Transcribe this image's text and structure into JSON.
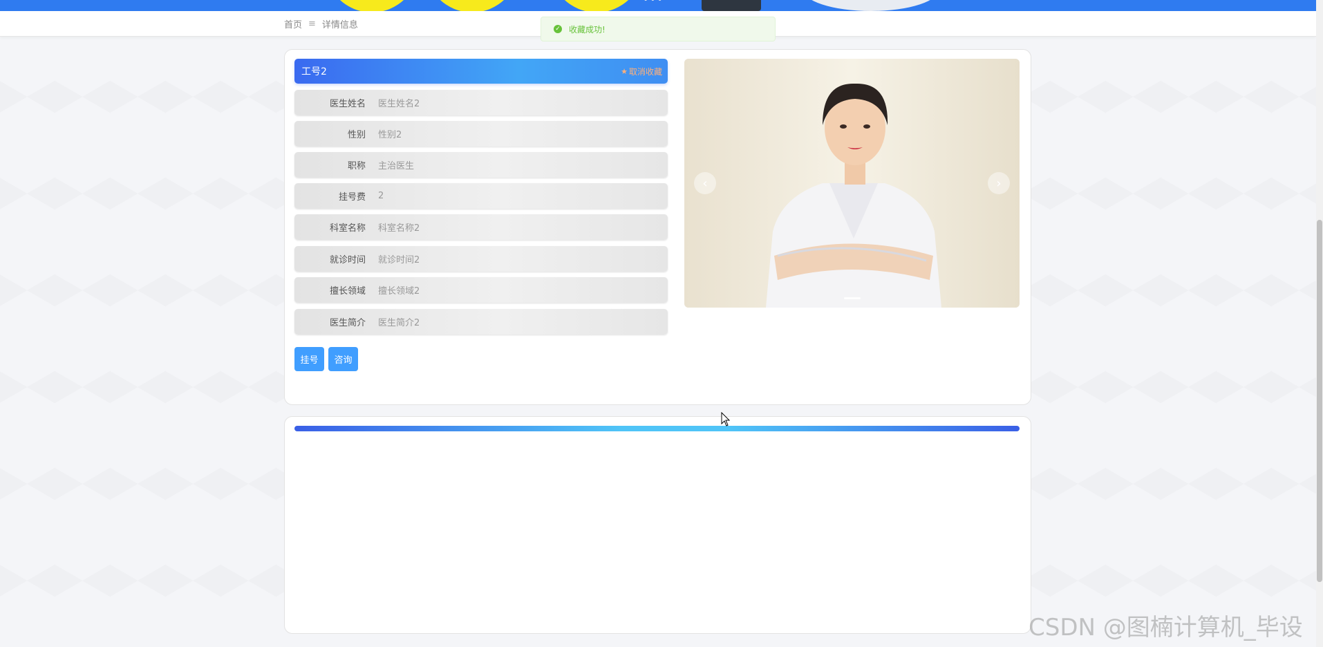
{
  "breadcrumb": {
    "home": "首页",
    "separator": "≡",
    "current": "详情信息"
  },
  "toast": {
    "icon": "check-circle-icon",
    "message": "收藏成功!"
  },
  "detail": {
    "title": "工号2",
    "favorite": {
      "icon": "star-icon",
      "label": "取消收藏"
    },
    "fields": [
      {
        "label": "医生姓名",
        "value": "医生姓名2"
      },
      {
        "label": "性别",
        "value": "性别2"
      },
      {
        "label": "职称",
        "value": "主治医生"
      },
      {
        "label": "挂号费",
        "value": "2"
      },
      {
        "label": "科室名称",
        "value": "科室名称2"
      },
      {
        "label": "就诊时间",
        "value": "就诊时间2"
      },
      {
        "label": "擅长领域",
        "value": "擅长领域2"
      },
      {
        "label": "医生简介",
        "value": "医生简介2"
      }
    ],
    "buttons": {
      "register": "挂号",
      "consult": "咨询"
    }
  },
  "carousel": {
    "prev": "‹",
    "next": "›"
  },
  "watermark": "CSDN @图楠计算机_毕设",
  "colors": {
    "banner": "#2f7bf0",
    "primary": "#409eff",
    "success": "#67c23a",
    "favorite": "#ffb07a"
  }
}
